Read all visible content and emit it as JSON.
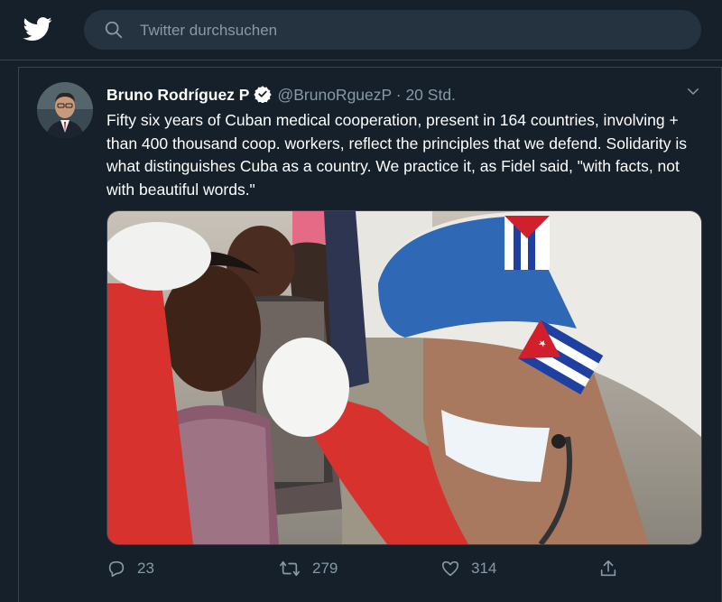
{
  "search": {
    "placeholder": "Twitter durchsuchen"
  },
  "tweet": {
    "author_name": "Bruno Rodríguez P",
    "handle": "@BrunoRguezP",
    "separator": "·",
    "time": "20 Std.",
    "text": "Fifty six years of Cuban medical cooperation, present in 164 countries, involving + than 400 thousand coop. workers, reflect the principles that we defend. Solidarity is what distinguishes Cuba as a country. We practice it, as Fidel said, \"with facts, not with beautiful words.\"",
    "replies": "23",
    "retweets": "279",
    "likes": "314"
  },
  "icons": {
    "logo": "twitter-bird-icon",
    "search": "search-icon",
    "verified": "verified-badge-icon",
    "more": "chevron-down-icon",
    "reply": "reply-icon",
    "retweet": "retweet-icon",
    "like": "heart-icon",
    "share": "share-icon"
  },
  "colors": {
    "background": "#15202b",
    "search_bg": "#253341",
    "muted": "#8899a6",
    "accent": "#1da1f2"
  }
}
